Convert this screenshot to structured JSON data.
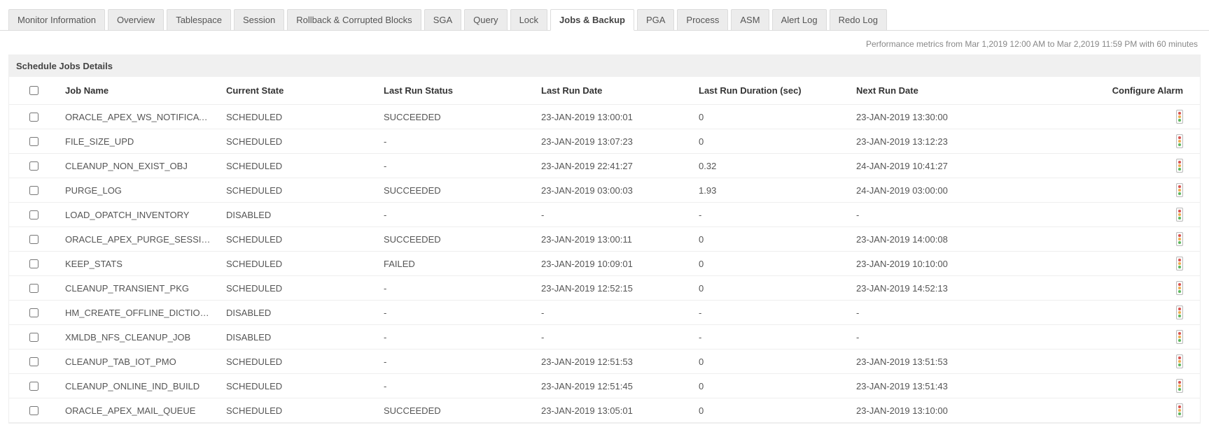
{
  "tabs": [
    "Monitor Information",
    "Overview",
    "Tablespace",
    "Session",
    "Rollback & Corrupted Blocks",
    "SGA",
    "Query",
    "Lock",
    "Jobs & Backup",
    "PGA",
    "Process",
    "ASM",
    "Alert Log",
    "Redo Log"
  ],
  "active_tab": "Jobs & Backup",
  "metrics_line": "Performance metrics from Mar 1,2019 12:00 AM to Mar 2,2019 11:59 PM with 60 minutes",
  "section_title": "Schedule Jobs Details",
  "columns": {
    "job_name": "Job Name",
    "current_state": "Current State",
    "last_run_status": "Last Run Status",
    "last_run_date": "Last Run Date",
    "last_run_duration": "Last Run Duration  (sec)",
    "next_run_date": "Next Run Date",
    "configure_alarm": "Configure Alarm"
  },
  "rows": [
    {
      "job_name": "ORACLE_APEX_WS_NOTIFICATIONS",
      "current_state": "SCHEDULED",
      "last_run_status": "SUCCEEDED",
      "last_run_date": "23-JAN-2019 13:00:01",
      "last_run_duration": "0",
      "next_run_date": "23-JAN-2019 13:30:00"
    },
    {
      "job_name": "FILE_SIZE_UPD",
      "current_state": "SCHEDULED",
      "last_run_status": "-",
      "last_run_date": "23-JAN-2019 13:07:23",
      "last_run_duration": "0",
      "next_run_date": "23-JAN-2019 13:12:23"
    },
    {
      "job_name": "CLEANUP_NON_EXIST_OBJ",
      "current_state": "SCHEDULED",
      "last_run_status": "-",
      "last_run_date": "23-JAN-2019 22:41:27",
      "last_run_duration": "0.32",
      "next_run_date": "24-JAN-2019 10:41:27"
    },
    {
      "job_name": "PURGE_LOG",
      "current_state": "SCHEDULED",
      "last_run_status": "SUCCEEDED",
      "last_run_date": "23-JAN-2019 03:00:03",
      "last_run_duration": "1.93",
      "next_run_date": "24-JAN-2019 03:00:00"
    },
    {
      "job_name": "LOAD_OPATCH_INVENTORY",
      "current_state": "DISABLED",
      "last_run_status": "-",
      "last_run_date": "-",
      "last_run_duration": "-",
      "next_run_date": "-"
    },
    {
      "job_name": "ORACLE_APEX_PURGE_SESSIONS",
      "current_state": "SCHEDULED",
      "last_run_status": "SUCCEEDED",
      "last_run_date": "23-JAN-2019 13:00:11",
      "last_run_duration": "0",
      "next_run_date": "23-JAN-2019 14:00:08"
    },
    {
      "job_name": "KEEP_STATS",
      "current_state": "SCHEDULED",
      "last_run_status": "FAILED",
      "last_run_date": "23-JAN-2019 10:09:01",
      "last_run_duration": "0",
      "next_run_date": "23-JAN-2019 10:10:00"
    },
    {
      "job_name": "CLEANUP_TRANSIENT_PKG",
      "current_state": "SCHEDULED",
      "last_run_status": "-",
      "last_run_date": "23-JAN-2019 12:52:15",
      "last_run_duration": "0",
      "next_run_date": "23-JAN-2019 14:52:13"
    },
    {
      "job_name": "HM_CREATE_OFFLINE_DICTIONARY",
      "current_state": "DISABLED",
      "last_run_status": "-",
      "last_run_date": "-",
      "last_run_duration": "-",
      "next_run_date": "-"
    },
    {
      "job_name": "XMLDB_NFS_CLEANUP_JOB",
      "current_state": "DISABLED",
      "last_run_status": "-",
      "last_run_date": "-",
      "last_run_duration": "-",
      "next_run_date": "-"
    },
    {
      "job_name": "CLEANUP_TAB_IOT_PMO",
      "current_state": "SCHEDULED",
      "last_run_status": "-",
      "last_run_date": "23-JAN-2019 12:51:53",
      "last_run_duration": "0",
      "next_run_date": "23-JAN-2019 13:51:53"
    },
    {
      "job_name": "CLEANUP_ONLINE_IND_BUILD",
      "current_state": "SCHEDULED",
      "last_run_status": "-",
      "last_run_date": "23-JAN-2019 12:51:45",
      "last_run_duration": "0",
      "next_run_date": "23-JAN-2019 13:51:43"
    },
    {
      "job_name": "ORACLE_APEX_MAIL_QUEUE",
      "current_state": "SCHEDULED",
      "last_run_status": "SUCCEEDED",
      "last_run_date": "23-JAN-2019 13:05:01",
      "last_run_duration": "0",
      "next_run_date": "23-JAN-2019 13:10:00"
    }
  ]
}
